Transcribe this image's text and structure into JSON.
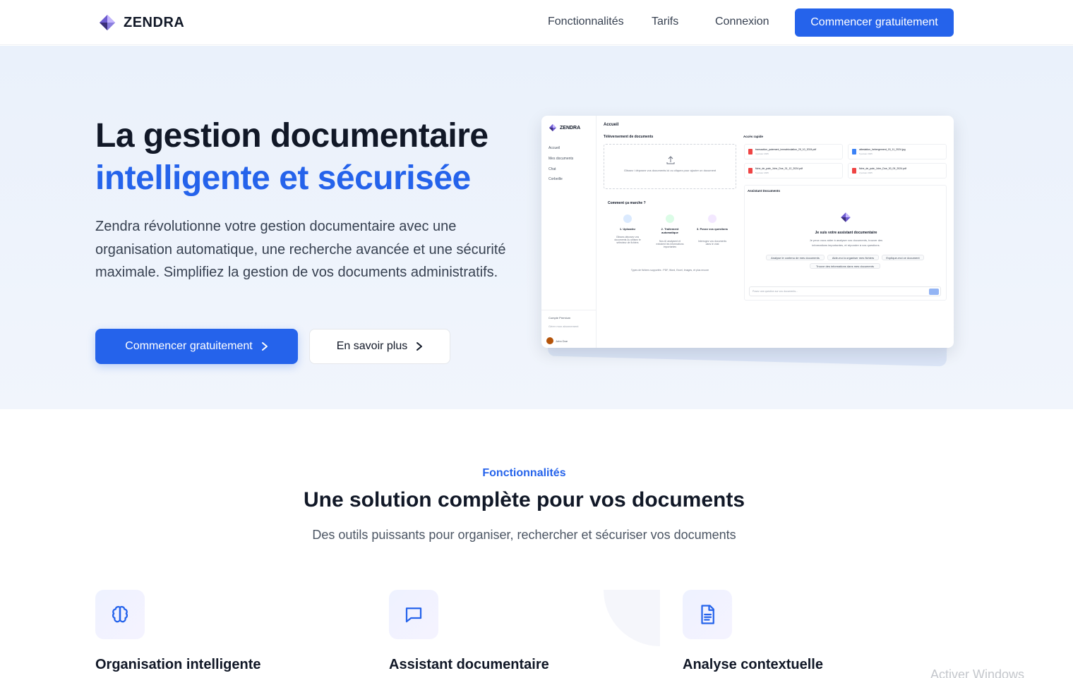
{
  "nav": {
    "brand": "ZENDRA",
    "links": [
      "Fonctionnalités",
      "Tarifs",
      "Connexion"
    ],
    "cta": "Commencer gratuitement"
  },
  "hero": {
    "title_line1": "La gestion documentaire",
    "title_line2": "intelligente et sécurisée",
    "description": "Zendra révolutionne votre gestion documentaire avec une organisation automatique, une recherche avancée et une sécurité maximale. Simplifiez la gestion de vos documents administratifs.",
    "primary_button": "Commencer gratuitement",
    "secondary_button": "En savoir plus"
  },
  "mockup": {
    "brand": "ZENDRA",
    "sidebar": [
      "Accueil",
      "Mes documents",
      "Chat",
      "Corbeille"
    ],
    "premium": "Compte Premium",
    "manage": "Gérer mon abonnement",
    "user": "John Doe",
    "page_title": "Accueil",
    "upload_title": "Téléversement de documents",
    "upload_hint": "Glissez / déposez vos documents ici ou cliquez pour ajouter un document",
    "how_title": "Comment ça marche ?",
    "steps": [
      {
        "title": "1. Uploadez",
        "desc": "Glissez-déposez vos documents ou utilisez le sélecteur de fichiers"
      },
      {
        "title": "2. Traitement automatique",
        "desc": "Nos AI analysent et extraient les informations importantes"
      },
      {
        "title": "3. Posez vos questions",
        "desc": "Interrogez vos documents dans le chat"
      }
    ],
    "file_types": "Types de fichiers supportés : PDF, Word, Excel, Images, et plus encore",
    "quick_title": "Accès rapide",
    "files": [
      {
        "name": "transaction_paiement_immatriculation_29_10_2024.pdf",
        "date": "4 janvier 2025"
      },
      {
        "name": "attestation_hebergement_15_11_2024.jpg",
        "date": "5 janvier 2025"
      },
      {
        "name": "fiche_de_paie_John_Doe_31_12_2024.pdf",
        "date": "5 janvier 2025"
      },
      {
        "name": "fiche_de_paie_John_Doe_30_09_2024.pdf",
        "date": "2 janvier 2025"
      }
    ],
    "assistant_title": "Assistant Documents",
    "assistant_heading": "Je suis votre assistant documentaire",
    "assistant_desc_1": "Je peux vous aider à analyser vos documents, trouver des",
    "assistant_desc_2": "informations importantes, et répondre à vos questions.",
    "chips": [
      "Analyse le contenu de mes documents",
      "Aide-moi à organiser mes fichiers",
      "Explique-moi ce document",
      "Trouve des informations dans mes documents"
    ],
    "input_placeholder": "Posez une question sur vos documents..."
  },
  "features": {
    "eyebrow": "Fonctionnalités",
    "title": "Une solution complète pour vos documents",
    "subtitle": "Des outils puissants pour organiser, rechercher et sécuriser vos documents",
    "items": [
      {
        "title": "Organisation intelligente",
        "icon": "brain-icon"
      },
      {
        "title": "Assistant documentaire",
        "icon": "chat-icon"
      },
      {
        "title": "Analyse contextuelle",
        "icon": "document-icon"
      }
    ]
  },
  "watermark": "Activer Windows",
  "colors": {
    "accent": "#2563eb",
    "hero_bg": "#eaf1fb",
    "text": "#111827"
  }
}
